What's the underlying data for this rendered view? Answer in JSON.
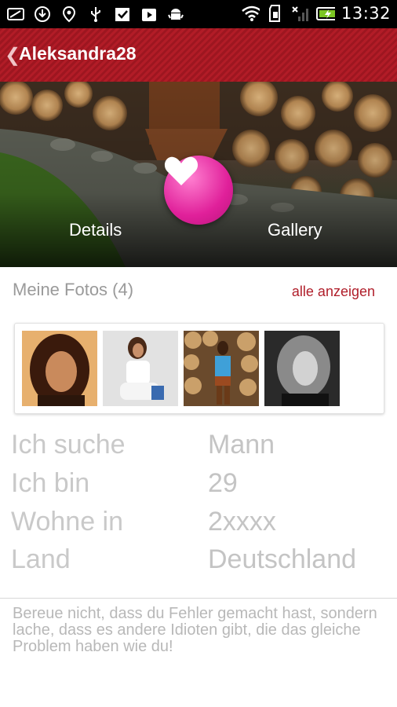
{
  "status_bar": {
    "time": "13:32",
    "icons": [
      "screenshot-icon",
      "download-icon",
      "location-icon",
      "usb-icon",
      "checkbox-icon",
      "play-store-icon",
      "android-debug-icon",
      "wifi-icon",
      "sd-card-icon",
      "no-signal-icon",
      "battery-charging-icon"
    ]
  },
  "action_bar": {
    "title": "Aleksandra28"
  },
  "hero": {
    "tab_details": "Details",
    "tab_gallery": "Gallery",
    "favorite_icon": "heart-icon"
  },
  "photos": {
    "title": "Meine Fotos (4)",
    "show_all": "alle anzeigen",
    "count": 4
  },
  "info": [
    {
      "label": "Ich suche",
      "value": "Mann"
    },
    {
      "label": "Ich bin",
      "value": "29"
    },
    {
      "label": "Wohne in",
      "value": "2xxxx"
    },
    {
      "label": "Land",
      "value": "Deutschland"
    }
  ],
  "quote": "Bereue nicht, dass du Fehler gemacht hast, sondern lache, dass es andere Idioten gibt, die das gleiche Problem haben wie du!",
  "colors": {
    "accent": "#b01e2a",
    "favorite": "#e0209a"
  }
}
